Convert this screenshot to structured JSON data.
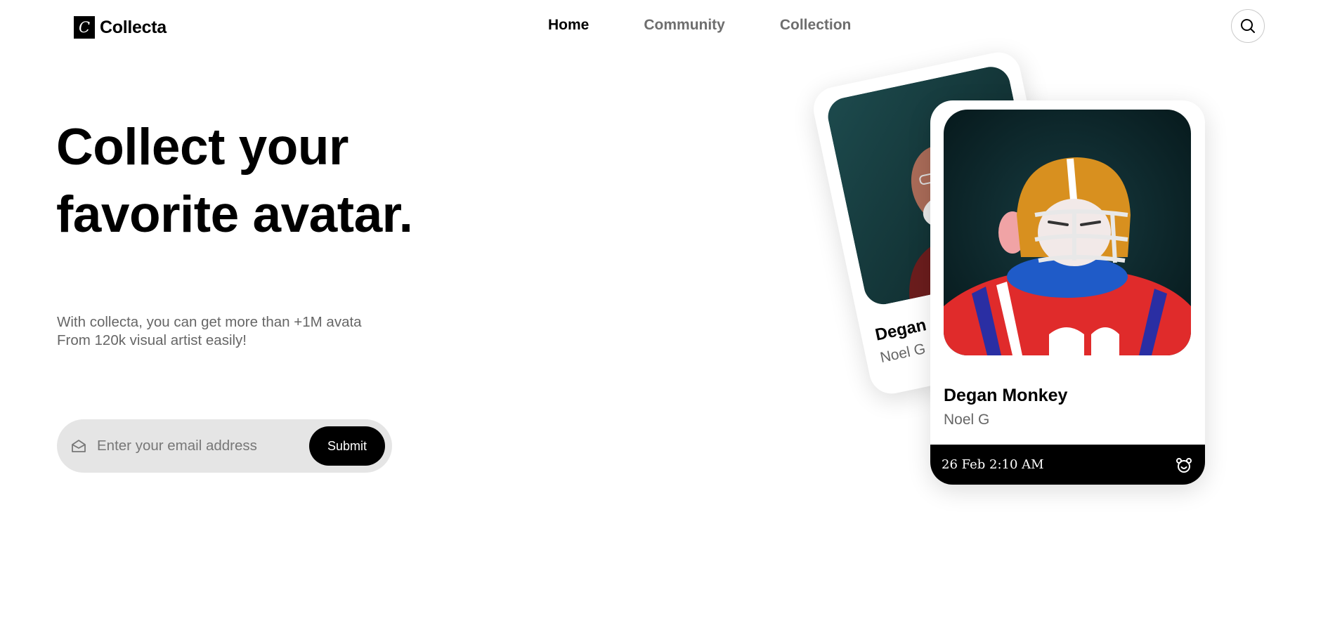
{
  "brand": {
    "logo_letter": "C",
    "name": "Collecta"
  },
  "nav": {
    "items": [
      {
        "label": "Home",
        "active": true
      },
      {
        "label": "Community",
        "active": false
      },
      {
        "label": "Collection",
        "active": false
      }
    ]
  },
  "search": {
    "icon": "search-icon"
  },
  "hero": {
    "title_line1": "Collect your",
    "title_line2": "favorite avatar.",
    "subtitle_line1": "With collecta, you can get more than +1M avata",
    "subtitle_line2": "From 120k visual artist easily!"
  },
  "signup": {
    "placeholder": "Enter your email address",
    "value": "",
    "submit_label": "Submit",
    "icon": "mail-icon"
  },
  "cards": {
    "back": {
      "name": "Degan Monkey",
      "artist": "Noel G",
      "image": "avatar-image-bearded-man"
    },
    "front": {
      "name": "Degan Monkey",
      "artist": "Noel G",
      "date": "26 Feb 2:10 AM",
      "image": "avatar-image-football-monkey",
      "icon": "bear-icon"
    }
  },
  "colors": {
    "accent": "#000000",
    "muted_text": "#6e6e6e",
    "input_bg": "#e5e5e5",
    "image_bg": "#0b2a2e"
  }
}
